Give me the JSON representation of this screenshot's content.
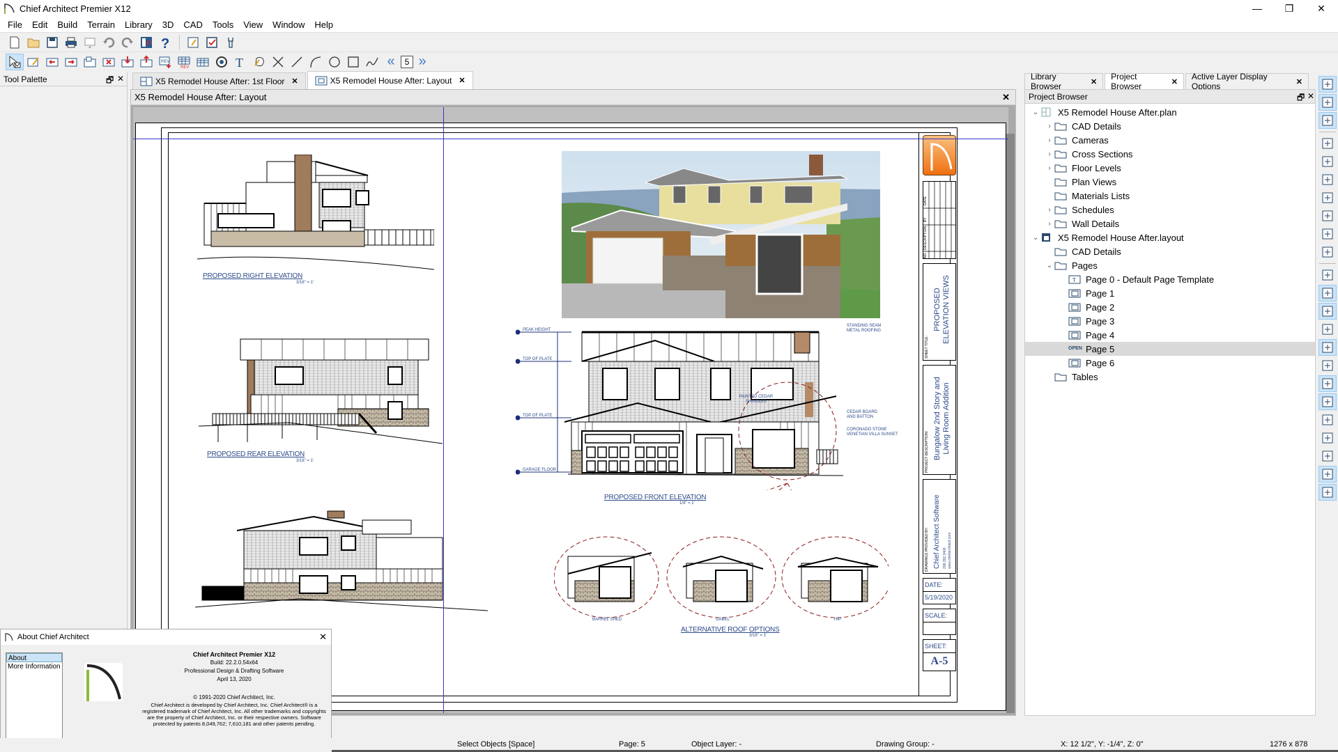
{
  "app": {
    "title": "Chief Architect Premier X12",
    "window_controls": {
      "minimize": "—",
      "restore": "❐",
      "close": "✕"
    }
  },
  "menu": [
    "File",
    "Edit",
    "Build",
    "Terrain",
    "Library",
    "3D",
    "CAD",
    "Tools",
    "View",
    "Window",
    "Help"
  ],
  "toolbar1": [
    {
      "name": "new-icon"
    },
    {
      "name": "open-folder-icon"
    },
    {
      "name": "save-icon"
    },
    {
      "name": "print-icon"
    },
    {
      "name": "print-preview-icon"
    },
    {
      "name": "undo-icon"
    },
    {
      "name": "redo-icon"
    },
    {
      "name": "preferences-icon"
    },
    {
      "name": "help-icon"
    },
    {
      "name": "edit-layout-icon"
    },
    {
      "name": "checklist-icon"
    },
    {
      "name": "wrench-icon"
    }
  ],
  "toolbar2": {
    "tools": [
      "select-objects-icon",
      "edit-view-icon",
      "prev-view-icon",
      "next-view-icon",
      "layout-box-icon",
      "delete-view-icon",
      "send-to-layout-icon",
      "layout-up-icon",
      "revision-icon",
      "revision-table-icon",
      "table-icon",
      "3d-view-icon",
      "text-icon",
      "callout-icon",
      "x-line-icon",
      "line-icon",
      "arc-icon",
      "circle-icon",
      "rectangle-icon",
      "spline-icon"
    ],
    "page_prev": "«",
    "page_number": "5",
    "page_next": "»"
  },
  "tool_palette": {
    "title": "Tool Palette",
    "float": "🗗",
    "close": "✕"
  },
  "doc_tabs": [
    {
      "label": "X5 Remodel House After:  1st Floor",
      "active": false
    },
    {
      "label": "X5 Remodel House After: Layout",
      "active": true
    }
  ],
  "doc_window": {
    "title": "X5 Remodel House After: Layout",
    "close": "✕",
    "views": {
      "right_elevation": {
        "title": "PROPOSED RIGHT ELEVATION",
        "scale": "3/16\" = 1'"
      },
      "rear_elevation": {
        "title": "PROPOSED REAR ELEVATION",
        "scale": "3/16\" = 1'"
      },
      "front_elevation": {
        "title": "PROPOSED FRONT ELEVATION",
        "scale": "1/4\" = 1'",
        "levels": [
          "PEAK HEIGHT",
          "TOP OF PLATE",
          "TOP OF PLATE",
          "GARAGE FLOOR"
        ],
        "notes": [
          "STANDING SEAM METAL ROOFING",
          "PAINTED CEDAR SHINGLES",
          "CEDAR BOARD AND BATTON",
          "CORONADO STONE VENETIAN VILLA SUNSET"
        ]
      },
      "roof_options": {
        "title": "ALTERNATIVE ROOF OPTIONS",
        "scale": "3/16\" = 1'",
        "options": [
          "BARREL SHED",
          "GABEL",
          "HIP"
        ]
      }
    },
    "title_block": {
      "revision_headers": [
        "NO.",
        "DESCRIPTION",
        "BY",
        "DATE"
      ],
      "sheet_title_label": "SHEET TITLE:",
      "sheet_title": "PROPOSED ELEVATION VIEWS",
      "project_desc_label": "PROJECT DESCRIPTION:",
      "project_desc": "Bungalow 2nd Story and Living Room Addition",
      "drawings_by_label": "DRAWINGS PROVIDED BY:",
      "drawings_by": "Chief Architect Software",
      "phone": "208.292.3400",
      "website": "www.chiefarchitect.com",
      "date_label": "DATE:",
      "date": "5/19/2020",
      "scale_label": "SCALE:",
      "scale": "",
      "sheet_label": "SHEET:",
      "sheet": "A-5"
    }
  },
  "right_tabs": [
    {
      "label": "Library Browser",
      "active": false
    },
    {
      "label": "Project Browser",
      "active": true
    },
    {
      "label": "Active Layer Display Options",
      "active": false
    }
  ],
  "project_browser": {
    "title": "Project Browser",
    "items": [
      {
        "label": "X5 Remodel House After.plan",
        "level": 0,
        "expander": "⌄",
        "icon": "plan-file-icon"
      },
      {
        "label": "CAD Details",
        "level": 1,
        "expander": "›",
        "icon": "folder-icon"
      },
      {
        "label": "Cameras",
        "level": 1,
        "expander": "›",
        "icon": "folder-icon"
      },
      {
        "label": "Cross Sections",
        "level": 1,
        "expander": "›",
        "icon": "folder-icon"
      },
      {
        "label": "Floor Levels",
        "level": 1,
        "expander": "›",
        "icon": "folder-icon"
      },
      {
        "label": "Plan Views",
        "level": 1,
        "expander": "",
        "icon": "folder-icon"
      },
      {
        "label": "Materials Lists",
        "level": 1,
        "expander": "",
        "icon": "folder-icon"
      },
      {
        "label": "Schedules",
        "level": 1,
        "expander": "›",
        "icon": "folder-icon"
      },
      {
        "label": "Wall Details",
        "level": 1,
        "expander": "›",
        "icon": "folder-icon"
      },
      {
        "label": "X5 Remodel House After.layout",
        "level": 0,
        "expander": "⌄",
        "icon": "layout-file-icon"
      },
      {
        "label": "CAD Details",
        "level": 1,
        "expander": "",
        "icon": "folder-icon"
      },
      {
        "label": "Pages",
        "level": 1,
        "expander": "⌄",
        "icon": "folder-icon"
      },
      {
        "label": "Page 0 - Default Page Template",
        "level": 2,
        "expander": "",
        "icon": "template-page-icon"
      },
      {
        "label": "Page 1",
        "level": 2,
        "expander": "",
        "icon": "layout-page-icon"
      },
      {
        "label": "Page 2",
        "level": 2,
        "expander": "",
        "icon": "layout-page-icon"
      },
      {
        "label": "Page 3",
        "level": 2,
        "expander": "",
        "icon": "layout-page-icon"
      },
      {
        "label": "Page 4",
        "level": 2,
        "expander": "",
        "icon": "layout-page-icon"
      },
      {
        "label": "Page 5",
        "level": 2,
        "expander": "",
        "icon": "open-page-icon",
        "badge": "OPEN",
        "selected": true
      },
      {
        "label": "Page 6",
        "level": 2,
        "expander": "",
        "icon": "layout-page-icon"
      },
      {
        "label": "Tables",
        "level": 1,
        "expander": "",
        "icon": "folder-icon"
      }
    ]
  },
  "right_toolbar": [
    "layer-display-icon",
    "layer-set-icon",
    "display-options-icon",
    "zoom-window-icon",
    "zoom-in-icon",
    "zoom-out-icon",
    "undo-zoom-icon",
    "fill-window-icon",
    "fill-window-all-icon",
    "pan-icon",
    "layer-stack-icon",
    "snap-object-icon",
    "object-snaps-icon",
    "line-weight-icon",
    "view-border-icon",
    "print-preview-small-icon",
    "dimension-snap-icon",
    "angle-snap-icon",
    "arc-snap-icon",
    "grid-icon",
    "grid-snap-icon",
    "bounding-snap-icon",
    "color-display-icon"
  ],
  "about_dialog": {
    "title": "About Chief Architect",
    "close": "✕",
    "list": [
      "About",
      "More Information"
    ],
    "product": "Chief Architect Premier X12",
    "build": "Build: 22.2.0.54x64",
    "tagline": "Professional Design & Drafting Software",
    "date": "April 13, 2020",
    "copyright": "© 1991-2020 Chief Architect, Inc.",
    "legal": "Chief Architect is developed by Chief Architect, Inc.  Chief Architect® is a registered trademark of Chief Architect, Inc.  All other trademarks and copyrights are the property of Chief Architect, Inc. or their respective owners.  Software protected by patents 8,049,762; 7,610,181 and other patents pending."
  },
  "status_bar": {
    "mode": "Select Objects [Space]",
    "page": "Page: 5",
    "object_layer": "Object Layer: -",
    "drawing_group": "Drawing Group: -",
    "coords": "X: 12 1/2\", Y: -1/4\", Z: 0\"",
    "size": "1276 x 878"
  }
}
